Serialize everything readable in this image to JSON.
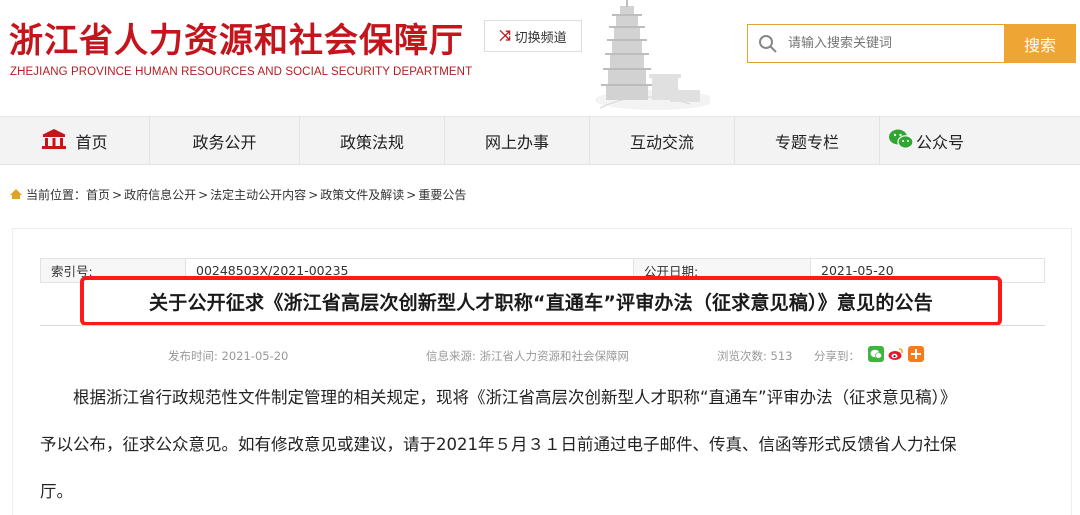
{
  "header": {
    "site_title": "浙江省人力资源和社会保障厅",
    "site_subtitle": "ZHEJIANG PROVINCE HUMAN RESOURCES AND SOCIAL SECURITY DEPARTMENT",
    "switch_channel_label": "切换频道",
    "search": {
      "placeholder": "请输入搜索关键词",
      "button_label": "搜索"
    }
  },
  "nav": {
    "items": [
      {
        "label": "首页",
        "icon": "home-icon"
      },
      {
        "label": "政务公开"
      },
      {
        "label": "政策法规"
      },
      {
        "label": "网上办事"
      },
      {
        "label": "互动交流"
      },
      {
        "label": "专题专栏"
      },
      {
        "label": "公众号",
        "icon": "wechat-icon"
      }
    ]
  },
  "breadcrumb": {
    "prefix": "当前位置：",
    "items": [
      "首页",
      "政府信息公开",
      "法定主动公开内容",
      "政策文件及解读",
      "重要公告"
    ],
    "separator": ">"
  },
  "article": {
    "meta": {
      "index_label": "索引号:",
      "index_value": "00248503X/2021-00235",
      "date_label": "公开日期:",
      "date_value": "2021-05-20"
    },
    "title": "关于公开征求《浙江省高层次创新型人才职称“直通车”评审办法（征求意见稿）》意见的公告",
    "publish_time": "发布时间: 2021-05-20",
    "source": "信息来源: 浙江省人力资源和社会保障网",
    "views": "浏览次数: 513",
    "share_label": "分享到：",
    "share_icons": [
      "wechat-share-icon",
      "weibo-share-icon",
      "more-share-icon"
    ],
    "paragraph_lines": [
      "根据浙江省行政规范性文件制定管理的相关规定，现将《浙江省高层次创新型人才职称“直通车”评审办法（征求意见稿）》",
      "予以公布，征求公众意见。如有修改意见或建议，请于2021年５月３１日前通过电子邮件、传真、信函等形式反馈省人力社保",
      "厅。"
    ]
  },
  "colors": {
    "brand_red": "#c4141c",
    "search_orange": "#efa534",
    "highlight_red": "#ff1a1a",
    "nav_bg": "#f3f3f3"
  }
}
